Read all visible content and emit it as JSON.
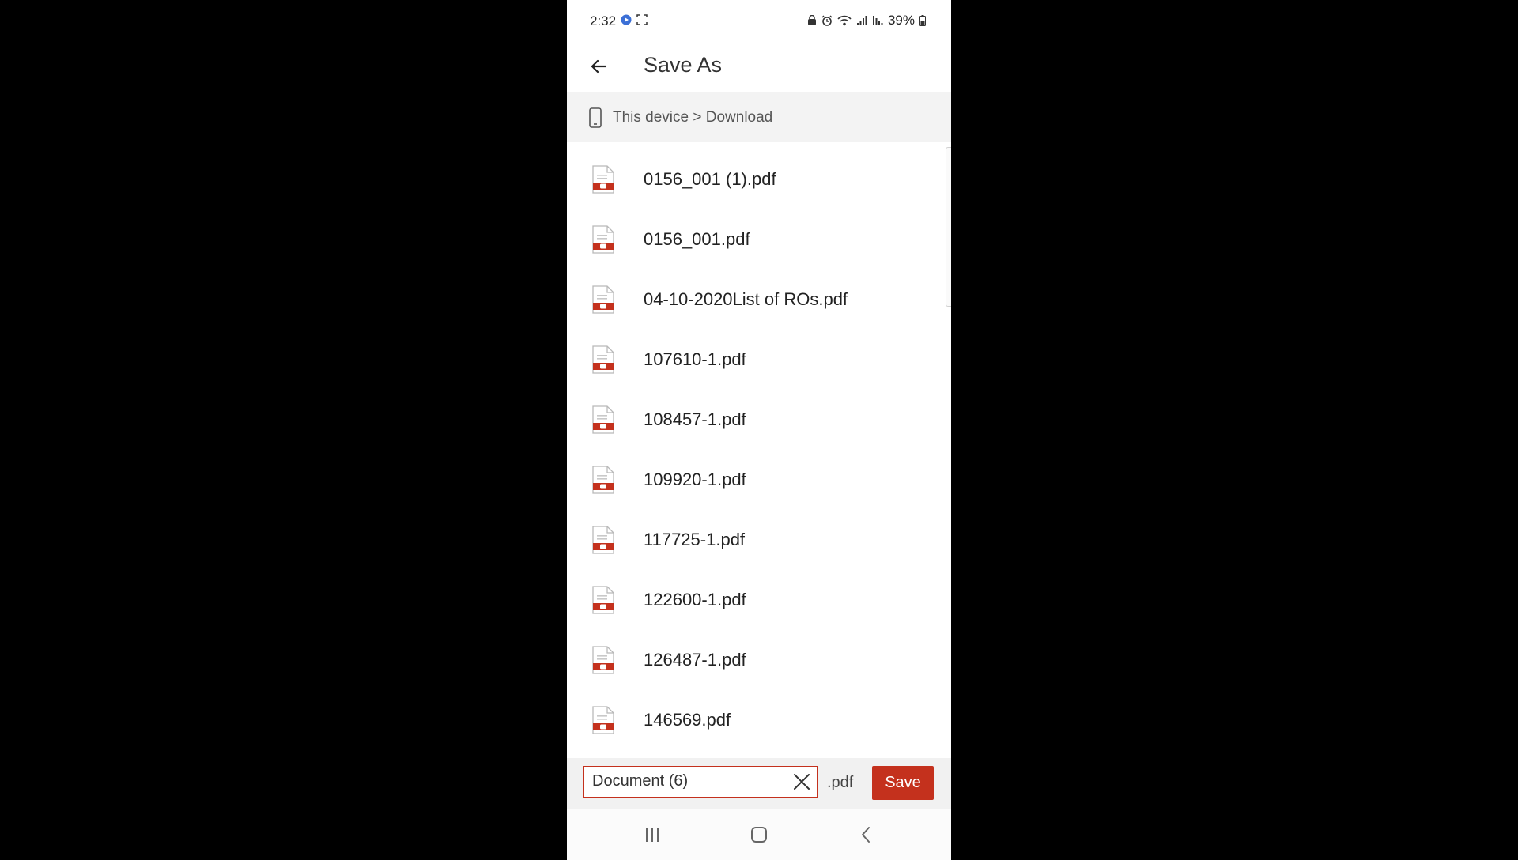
{
  "status_bar": {
    "time": "2:32",
    "battery": "39%"
  },
  "header": {
    "title": "Save As"
  },
  "breadcrumb": {
    "path": "This device > Download"
  },
  "files": [
    {
      "name": "0156_001 (1).pdf"
    },
    {
      "name": "0156_001.pdf"
    },
    {
      "name": "04-10-2020List of ROs.pdf"
    },
    {
      "name": "107610-1.pdf"
    },
    {
      "name": "108457-1.pdf"
    },
    {
      "name": "109920-1.pdf"
    },
    {
      "name": "117725-1.pdf"
    },
    {
      "name": "122600-1.pdf"
    },
    {
      "name": "126487-1.pdf"
    },
    {
      "name": "146569.pdf"
    }
  ],
  "save_bar": {
    "filename_value": "Document (6)",
    "extension": ".pdf",
    "save_label": "Save"
  },
  "colors": {
    "accent": "#c4311d",
    "background": "#000000"
  },
  "icons": {
    "back": "arrow-left-icon",
    "device": "phone-icon",
    "file": "pdf-file-icon",
    "clear": "close-icon",
    "nav_recents": "recents-icon",
    "nav_home": "home-icon",
    "nav_back": "chevron-left-icon"
  }
}
